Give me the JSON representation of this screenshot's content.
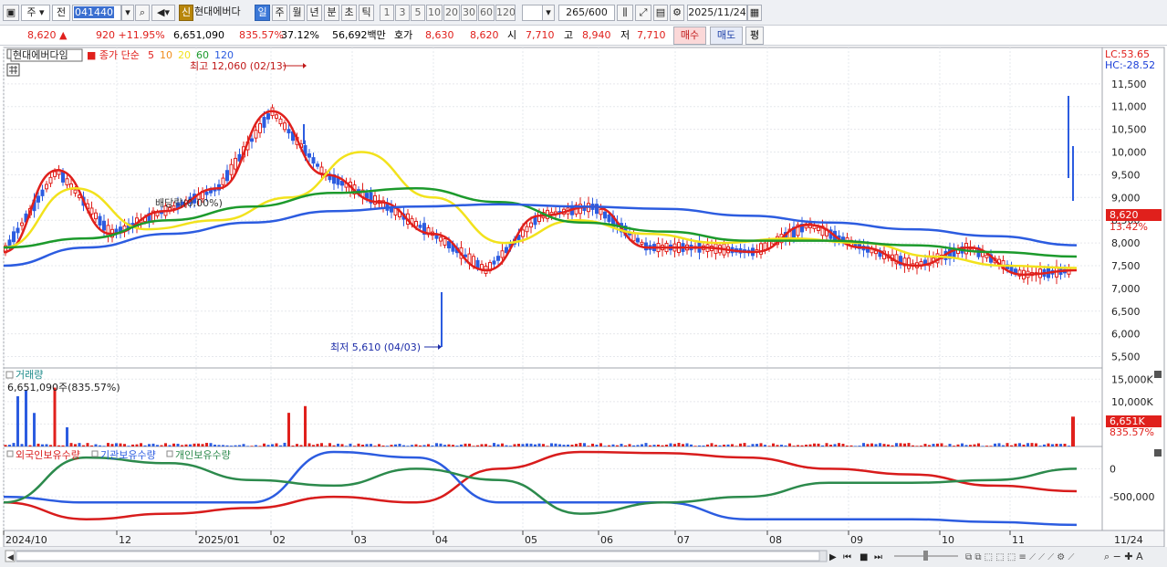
{
  "toolbar": {
    "period_label": "주",
    "prev_label": "전",
    "stock_code": "041440",
    "credit_badge": "신",
    "stock_name": "현대에버다",
    "intervals": [
      "일",
      "주",
      "월",
      "년",
      "분",
      "초",
      "틱"
    ],
    "active_interval": "일",
    "minute_options": [
      "1",
      "3",
      "5",
      "10",
      "20",
      "30",
      "60",
      "120"
    ],
    "bar_count": "265",
    "bar_total": "/600",
    "date": "2025/11/24"
  },
  "quote": {
    "price": "8,620 ▲",
    "change": "920 +11.95%",
    "volume": "6,651,090",
    "volume_ratio": "835.57%",
    "turnover": "37.12%",
    "amount": "56,692백만",
    "ask_label": "호가",
    "ask_price": "8,630",
    "bid_price": "8,620",
    "open_label": "시",
    "open": "7,710",
    "high_label": "고",
    "high": "8,940",
    "low_label": "저",
    "low": "7,710",
    "buy_label": "매수",
    "sell_label": "매도",
    "eval_label": "평"
  },
  "legend": {
    "stock_name": "현대에버다임",
    "ma_title": "종가 단순",
    "ma_periods": [
      "5",
      "10",
      "20",
      "60",
      "120"
    ],
    "ma_colors": [
      "#e0201c",
      "#f08c1c",
      "#f2e21c",
      "#1c9a2c",
      "#2c5ce0"
    ]
  },
  "price_panel": {
    "lc_label": "LC:53.65",
    "hc_label": "HC:-28.52",
    "high_annotation": "최고 12,060 (02/13)",
    "low_annotation": "최저 5,610 (04/03)",
    "dividend_annotation": "배당락(0.00%)",
    "current_price_tag": "8,620",
    "current_change_tag": "13.42%"
  },
  "volume_panel": {
    "title": "거래량",
    "value_label": "6,651,090주(835.57%)",
    "current_tag": "6,651K",
    "current_ratio": "835.57%"
  },
  "holding_panel": {
    "series_labels": [
      "외국인보유수량",
      "기관보유수량",
      "개인보유수량"
    ],
    "series_colors": [
      "#d81c1c",
      "#2c5ce0",
      "#2c8a4c"
    ]
  },
  "x_axis": {
    "labels": [
      "2024/10",
      "12",
      "2025/01",
      "02",
      "03",
      "04",
      "05",
      "06",
      "07",
      "08",
      "09",
      "10",
      "11"
    ],
    "right_label": "11/24"
  },
  "chart_data": [
    {
      "type": "candlestick",
      "title": "현대에버다임",
      "ylim": [
        5250,
        12300
      ],
      "yticks": [
        5500,
        6000,
        6500,
        7000,
        7500,
        8000,
        8500,
        9000,
        9500,
        10000,
        10500,
        11000,
        11500
      ],
      "ytick_labels": [
        "5,500",
        "6,000",
        "6,500",
        "7,000",
        "7,500",
        "8,000",
        "8,500",
        "9,000",
        "9,500",
        "10,000",
        "10,500",
        "11,000",
        "11,500"
      ],
      "series": [
        {
          "name": "5",
          "color": "#e0201c",
          "x": [
            "2024/10",
            "2024/11",
            "2024/12",
            "2025/01",
            "2025/02",
            "2025/02/20",
            "2025/03",
            "2025/03/20",
            "2025/04",
            "2025/04/15",
            "2025/05",
            "2025/05/20",
            "2025/06",
            "2025/07",
            "2025/08",
            "2025/08/20",
            "2025/09",
            "2025/10",
            "2025/10/20",
            "2025/11",
            "2025/11/24"
          ],
          "values": [
            7800,
            9600,
            8200,
            8700,
            9200,
            10900,
            9500,
            8900,
            8200,
            7400,
            8600,
            8800,
            7900,
            7900,
            7800,
            8400,
            7900,
            7500,
            7900,
            7300,
            7400
          ]
        },
        {
          "name": "20",
          "color": "#f2e21c",
          "x": [
            "2024/10",
            "2024/11",
            "2024/12",
            "2025/01",
            "2025/02",
            "2025/03",
            "2025/04",
            "2025/04/20",
            "2025/05",
            "2025/06",
            "2025/07",
            "2025/08",
            "2025/09",
            "2025/10",
            "2025/11",
            "2025/11/24"
          ],
          "values": [
            7900,
            9200,
            8300,
            8500,
            9000,
            10000,
            9000,
            8000,
            8500,
            8200,
            8000,
            8100,
            8000,
            7700,
            7500,
            7450
          ]
        },
        {
          "name": "60",
          "color": "#1c9a2c",
          "x": [
            "2024/10",
            "2024/12",
            "2025/01",
            "2025/02",
            "2025/03",
            "2025/04",
            "2025/05",
            "2025/06",
            "2025/07",
            "2025/08",
            "2025/09",
            "2025/10",
            "2025/11",
            "2025/11/24"
          ],
          "values": [
            7900,
            8100,
            8500,
            8800,
            9100,
            9200,
            8900,
            8450,
            8250,
            8050,
            8050,
            7950,
            7800,
            7700
          ]
        },
        {
          "name": "120",
          "color": "#2c5ce0",
          "x": [
            "2024/10",
            "2024/12",
            "2025/01",
            "2025/02",
            "2025/03",
            "2025/04",
            "2025/05",
            "2025/06",
            "2025/07",
            "2025/08",
            "2025/09",
            "2025/10",
            "2025/11",
            "2025/11/24"
          ],
          "values": [
            7500,
            7900,
            8200,
            8450,
            8700,
            8800,
            8850,
            8800,
            8750,
            8600,
            8450,
            8300,
            8150,
            7950
          ]
        }
      ]
    },
    {
      "type": "bar",
      "title": "거래량",
      "ylim": [
        0,
        17500
      ],
      "yticks": [
        5000,
        10000,
        15000
      ],
      "ytick_labels": [
        "",
        "10,000K",
        "15,000K"
      ],
      "x": [
        "2024/10",
        "2024/11",
        "2025/02",
        "2025/11/24"
      ],
      "values": [
        300,
        14000,
        9000,
        6651
      ]
    },
    {
      "type": "line",
      "title": "보유수량",
      "ylim": [
        -1100000,
        300000
      ],
      "yticks": [
        0,
        -500000
      ],
      "ytick_labels": [
        "0",
        "-500,000"
      ],
      "series": [
        {
          "name": "외국인보유수량",
          "color": "#d81c1c",
          "x": [
            "2024/10",
            "2024/12",
            "2025/01",
            "2025/02",
            "2025/03",
            "2025/04",
            "2025/05",
            "2025/06",
            "2025/07",
            "2025/08",
            "2025/09",
            "2025/10",
            "2025/11",
            "2025/11/24"
          ],
          "values": [
            -600000,
            -900000,
            -800000,
            -700000,
            -500000,
            -600000,
            0,
            300000,
            280000,
            200000,
            0,
            -100000,
            -300000,
            -400000
          ]
        },
        {
          "name": "기관보유수량",
          "color": "#2c5ce0",
          "x": [
            "2024/10",
            "2024/12",
            "2025/01",
            "2025/02",
            "2025/03",
            "2025/04",
            "2025/05",
            "2025/06",
            "2025/07",
            "2025/08",
            "2025/09",
            "2025/10",
            "2025/11",
            "2025/11/24"
          ],
          "values": [
            -500000,
            -600000,
            -600000,
            -600000,
            300000,
            200000,
            -600000,
            -600000,
            -600000,
            -900000,
            -900000,
            -900000,
            -950000,
            -1000000
          ]
        },
        {
          "name": "개인보유수량",
          "color": "#2c8a4c",
          "x": [
            "2024/10",
            "2024/12",
            "2025/01",
            "2025/02",
            "2025/03",
            "2025/04",
            "2025/05",
            "2025/06",
            "2025/07",
            "2025/08",
            "2025/09",
            "2025/10",
            "2025/11",
            "2025/11/24"
          ],
          "values": [
            -600000,
            200000,
            100000,
            -200000,
            -300000,
            0,
            -200000,
            -800000,
            -600000,
            -500000,
            -250000,
            -250000,
            -200000,
            0
          ]
        }
      ]
    }
  ]
}
